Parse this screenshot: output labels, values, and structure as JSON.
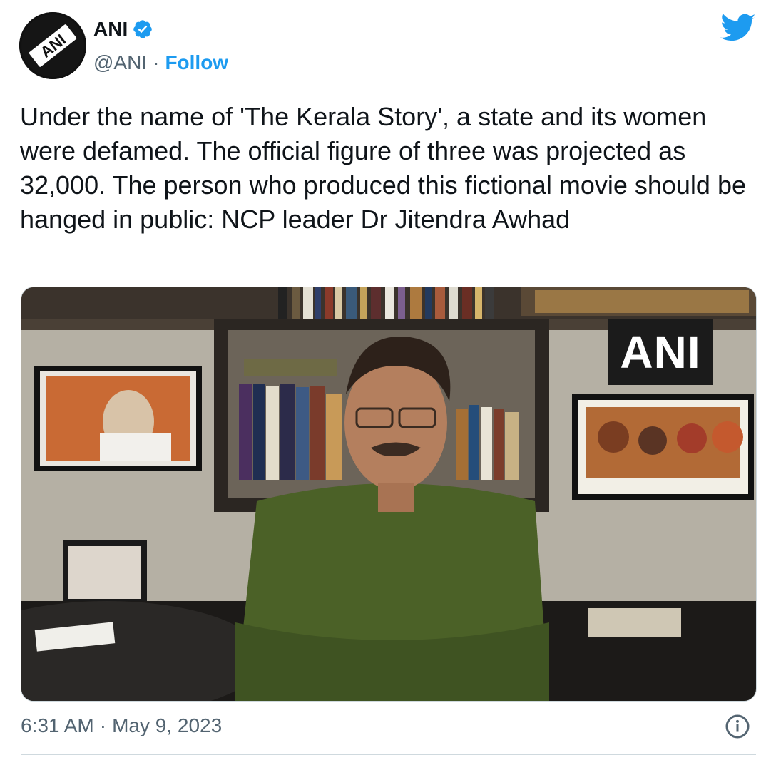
{
  "header": {
    "name": "ANI",
    "handle": "@ANI",
    "separator": "·",
    "follow_label": "Follow",
    "avatar_logo_text": "ANI",
    "verified_icon": "verified-badge-icon",
    "platform_icon": "twitter-bird-icon"
  },
  "tweet": {
    "text": "Under the name of 'The Kerala Story', a state and its women were defamed. The official figure of three was projected as 32,000. The person who produced this fictional movie should be hanged in public: NCP leader Dr Jitendra Awhad"
  },
  "media": {
    "watermark": "ANI"
  },
  "footer": {
    "time": "6:31 AM",
    "separator": "·",
    "date": "May 9, 2023",
    "info_icon": "info-icon"
  },
  "colors": {
    "link": "#1d9bf0",
    "verified": "#1d9bf0",
    "text": "#0f1419",
    "secondary": "#536471",
    "border": "#cfd9de"
  }
}
